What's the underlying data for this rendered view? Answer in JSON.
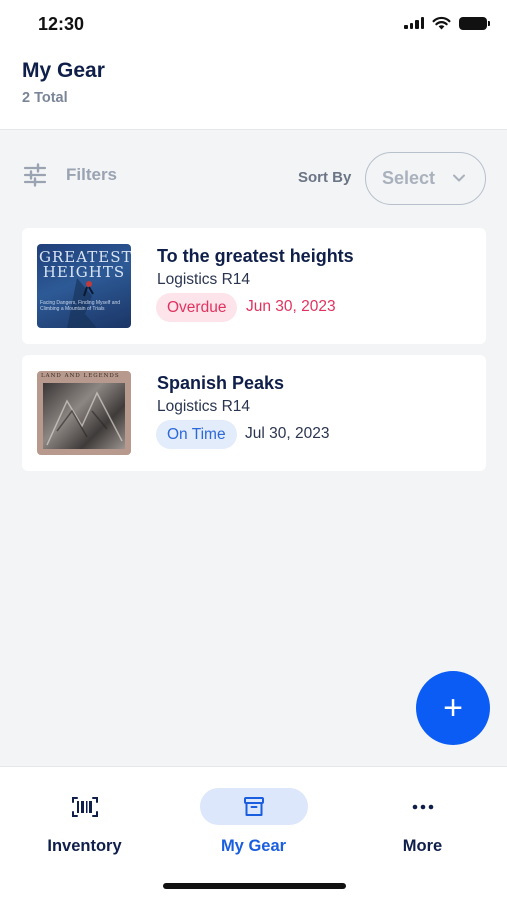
{
  "status_bar": {
    "time": "12:30"
  },
  "header": {
    "title": "My Gear",
    "subtitle": "2 Total"
  },
  "toolbar": {
    "filters_label": "Filters",
    "sort_label": "Sort By",
    "select_label": "Select"
  },
  "items": [
    {
      "title": "To the greatest heights",
      "location": "Logistics R14",
      "status": "Overdue",
      "due_date": "Jun 30, 2023",
      "cover_text": "GREATEST HEIGHTS",
      "cover_subtext": "Facing Dangers, Finding Myself and Climbing a Mountain of Trials"
    },
    {
      "title": "Spanish Peaks",
      "location": "Logistics R14",
      "status": "On Time",
      "due_date": "Jul 30, 2023",
      "cover_text": "LAND AND LEGENDS"
    }
  ],
  "fab": {
    "label": "+"
  },
  "bottom_nav": [
    {
      "label": "Inventory",
      "icon": "barcode-icon"
    },
    {
      "label": "My Gear",
      "icon": "archive-box-icon",
      "active": true
    },
    {
      "label": "More",
      "icon": "ellipsis-icon"
    }
  ],
  "colors": {
    "primary": "#0a5cf5",
    "title": "#0f1f4a",
    "overdue": "#e0335f",
    "ontime": "#2c69d8"
  }
}
